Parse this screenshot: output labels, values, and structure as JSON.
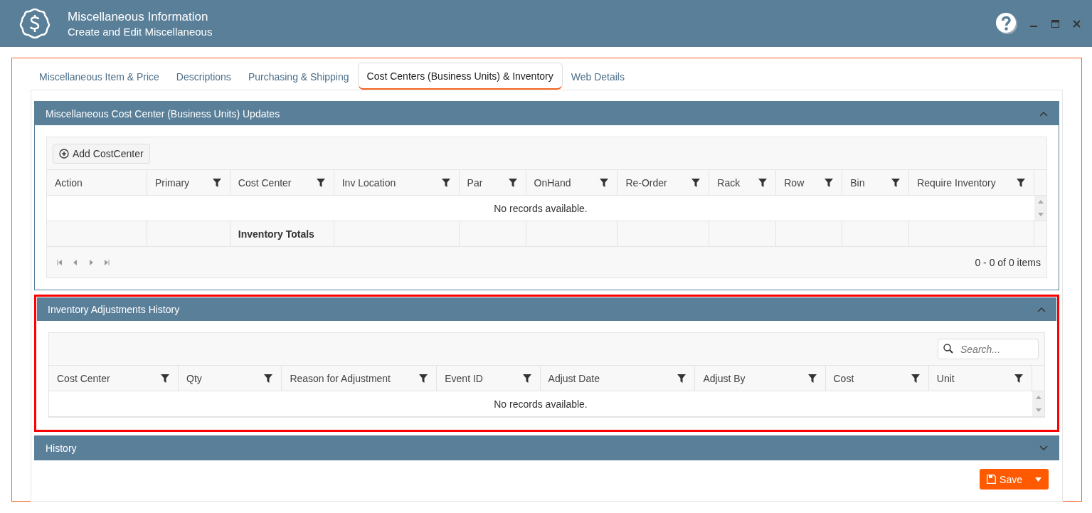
{
  "window": {
    "title": "Miscellaneous Information",
    "subtitle": "Create and Edit Miscellaneous"
  },
  "tabs": [
    {
      "label": "Miscellaneous Item & Price",
      "selected": false
    },
    {
      "label": "Descriptions",
      "selected": false
    },
    {
      "label": "Purchasing & Shipping",
      "selected": false
    },
    {
      "label": "Cost Centers (Business Units) & Inventory",
      "selected": true
    },
    {
      "label": "Web Details",
      "selected": false
    }
  ],
  "panels": [
    {
      "title": "Miscellaneous Cost Center (Business Units) Updates",
      "expanded": true,
      "highlighted": false,
      "toolbar_button": "Add CostCenter",
      "columns": [
        {
          "label": "Action",
          "filter": false
        },
        {
          "label": "Primary",
          "filter": true
        },
        {
          "label": "Cost Center",
          "filter": true,
          "total_label": "Inventory Totals"
        },
        {
          "label": "Inv Location",
          "filter": true
        },
        {
          "label": "Par",
          "filter": true
        },
        {
          "label": "OnHand",
          "filter": true
        },
        {
          "label": "Re-Order",
          "filter": true
        },
        {
          "label": "Rack",
          "filter": true
        },
        {
          "label": "Row",
          "filter": true
        },
        {
          "label": "Bin",
          "filter": true
        },
        {
          "label": "Require Inventory",
          "filter": true
        }
      ],
      "empty_message": "No records available.",
      "pager_info": "0 - 0 of 0 items"
    },
    {
      "title": "Inventory Adjustments History",
      "expanded": true,
      "highlighted": true,
      "search": {
        "placeholder": "Search..."
      },
      "columns": [
        {
          "label": "Cost Center",
          "filter": true
        },
        {
          "label": "Qty",
          "filter": true
        },
        {
          "label": "Reason for Adjustment",
          "filter": true
        },
        {
          "label": "Event ID",
          "filter": true
        },
        {
          "label": "Adjust Date",
          "filter": true
        },
        {
          "label": "Adjust By",
          "filter": true
        },
        {
          "label": "Cost",
          "filter": true
        },
        {
          "label": "Unit",
          "filter": true
        }
      ],
      "empty_message": "No records available."
    },
    {
      "title": "History",
      "expanded": false,
      "highlighted": false
    }
  ],
  "save_button": "Save"
}
